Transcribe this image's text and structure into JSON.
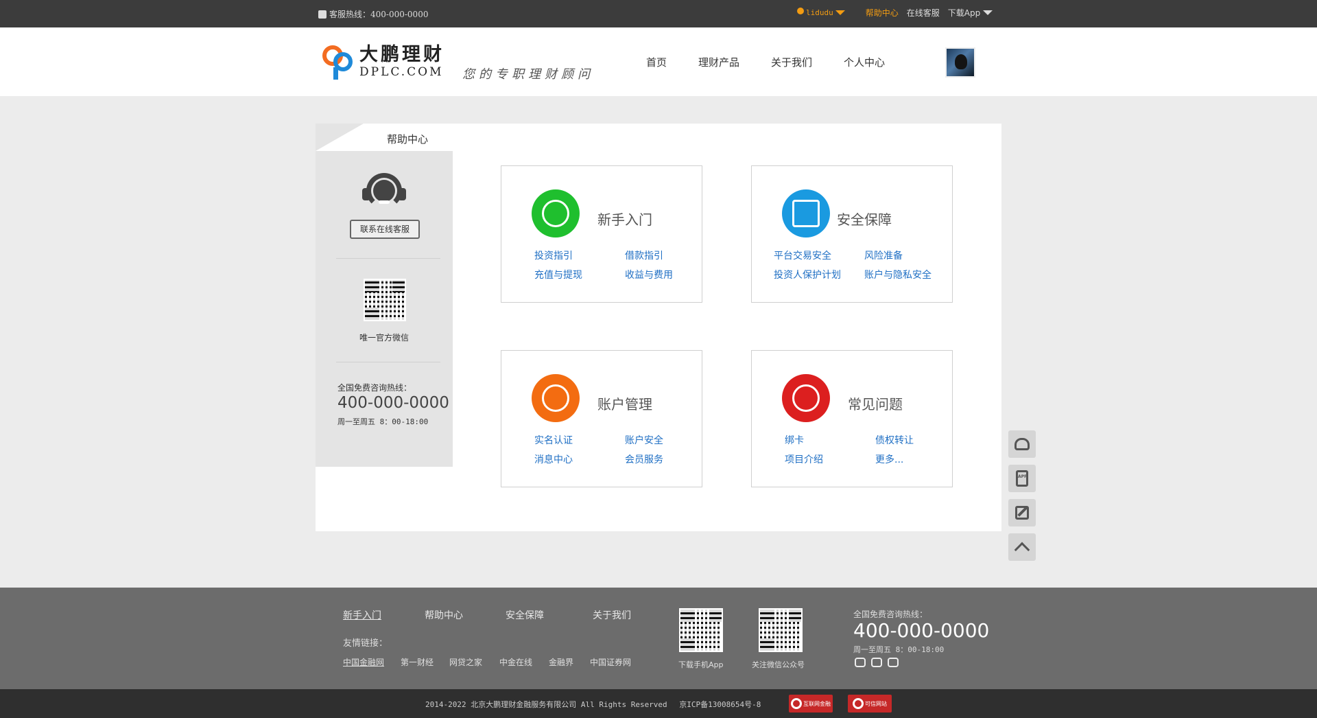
{
  "topbar": {
    "hotline": "客服热线：400-000-0000",
    "username": "lidudu",
    "help": "帮助中心",
    "online_service": "在线客服",
    "download_app": "下载App"
  },
  "header": {
    "logo_cn": "大鹏理财",
    "logo_en": "DPLC.COM",
    "slogan": "您的专职理财顾问",
    "nav": [
      "首页",
      "理财产品",
      "关于我们",
      "个人中心"
    ]
  },
  "sidebar": {
    "title": "帮助中心",
    "contact_button": "联系在线客服",
    "wechat_label": "唯一官方微信",
    "hotline_label": "全国免费咨询热线：",
    "hotline_number": "400-000-0000",
    "hours": "周一至周五 8：00-18:00"
  },
  "cards": [
    {
      "title": "新手入门",
      "color": "#1fbf2e",
      "links": [
        "投资指引",
        "借款指引",
        "充值与提现",
        "收益与费用"
      ]
    },
    {
      "title": "安全保障",
      "color": "#1a9ae0",
      "links": [
        "平台交易安全",
        "风险准备",
        "投资人保护计划",
        "账户与隐私安全"
      ]
    },
    {
      "title": "账户管理",
      "color": "#f36c11",
      "links": [
        "实名认证",
        "账户安全",
        "消息中心",
        "会员服务"
      ]
    },
    {
      "title": "常见问题",
      "color": "#dc1f1f",
      "links": [
        "绑卡",
        "债权转让",
        "项目介绍",
        "更多..."
      ]
    }
  ],
  "float_bar": {
    "icons": [
      "headset-icon",
      "app-icon",
      "edit-icon",
      "back-to-top-icon"
    ],
    "app_text": "APP"
  },
  "footer": {
    "nav": [
      "新手入门",
      "帮助中心",
      "安全保障",
      "关于我们"
    ],
    "links_title": "友情链接：",
    "links": [
      "中国金融网",
      "第一财经",
      "网贷之家",
      "中金在线",
      "金融界",
      "中国证券网"
    ],
    "qr_app": "下载手机App",
    "qr_wechat": "关注微信公众号",
    "hotline_label": "全国免费咨询热线：",
    "hotline_number": "400-000-0000",
    "hours": "周一至周五 8：00-18:00"
  },
  "bottom": {
    "copyright": "2014-2022 北京大鹏理财金融服务有限公司 All Rights Reserved　 京ICP备13008654号-8",
    "badge1": "互联网金融",
    "badge2": "可信网站"
  }
}
